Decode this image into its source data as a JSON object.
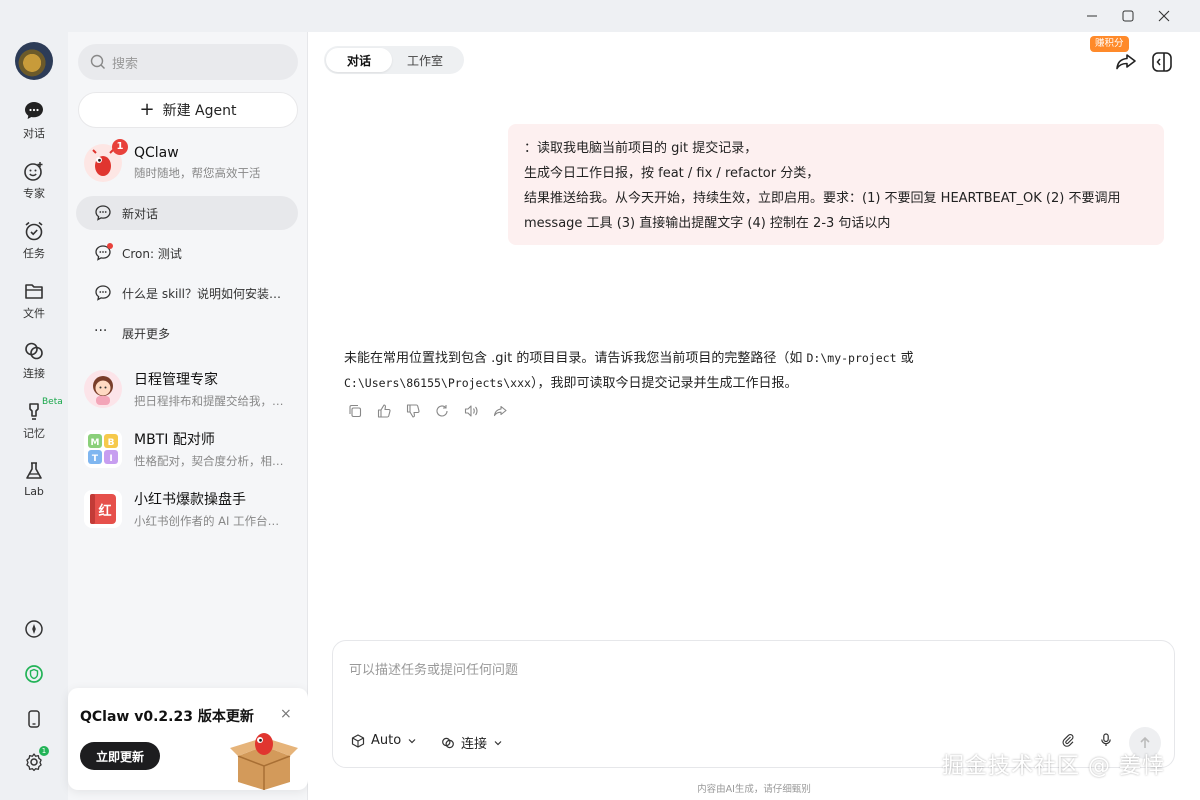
{
  "rail": {
    "items": [
      {
        "label": "对话",
        "icon": "chat-bubble-icon"
      },
      {
        "label": "专家",
        "icon": "smiley-plus-icon"
      },
      {
        "label": "任务",
        "icon": "alarm-clock-icon"
      },
      {
        "label": "文件",
        "icon": "folder-icon"
      },
      {
        "label": "连接",
        "icon": "link-icon"
      },
      {
        "label": "记忆",
        "icon": "lightbulb-icon",
        "tag": "Beta"
      },
      {
        "label": "Lab",
        "icon": "flask-icon"
      }
    ],
    "settings_badge": "1"
  },
  "sidebar": {
    "search_placeholder": "搜索",
    "new_agent_label": "新建 Agent",
    "primary_agent": {
      "name": "QClaw",
      "subtitle": "随时随地，帮您高效干活",
      "badge": "1"
    },
    "conversations": [
      {
        "label": "新对话",
        "active": true,
        "unread": false
      },
      {
        "label": "Cron: 测试",
        "active": false,
        "unread": true
      },
      {
        "label": "什么是 skill？说明如何安装…",
        "active": false,
        "unread": false
      }
    ],
    "expand_label": "展开更多",
    "agents": [
      {
        "name": "日程管理专家",
        "subtitle": "把日程排布和提醒交给我，…"
      },
      {
        "name": "MBTI 配对师",
        "subtitle": "性格配对，契合度分析，相…"
      },
      {
        "name": "小红书爆款操盘手",
        "subtitle": "小红书创作者的 AI 工作台…"
      }
    ],
    "update_card": {
      "title": "QClaw v0.2.23 版本更新",
      "button": "立即更新",
      "close": "×"
    }
  },
  "main": {
    "tabs": [
      {
        "label": "对话",
        "active": true
      },
      {
        "label": "工作室",
        "active": false
      }
    ],
    "points_badge": "赚积分",
    "user_message": {
      "line1": "：读取我电脑当前项目的 git 提交记录，",
      "line2": "生成今日工作日报，按 feat / fix / refactor 分类，",
      "line3": "结果推送给我。从今天开始，持续生效，立即启用。要求：(1) 不要回复 HEARTBEAT_OK (2) 不要调用",
      "line4": "message 工具 (3) 直接输出提醒文字 (4) 控制在 2-3 句话以内"
    },
    "ai_message": {
      "part1": "未能在常用位置找到包含 .git 的项目目录。请告诉我您当前项目的完整路径（如 ",
      "code1": "D:\\my-project",
      "part2": " 或",
      "code2": "C:\\Users\\86155\\Projects\\xxx",
      "part3": "），我即可读取今日提交记录并生成工作日报。"
    },
    "composer": {
      "placeholder": "可以描述任务或提问任何问题",
      "model_label": "Auto",
      "connect_label": "连接"
    },
    "disclaimer": "内容由AI生成，请仔细甄别"
  },
  "watermark": "掘金技术社区 @ 姜悻",
  "colors": {
    "accent_red": "#e8413b",
    "green": "#22b357",
    "orange": "#ff8a2a",
    "user_bubble": "#fdf0f0"
  }
}
